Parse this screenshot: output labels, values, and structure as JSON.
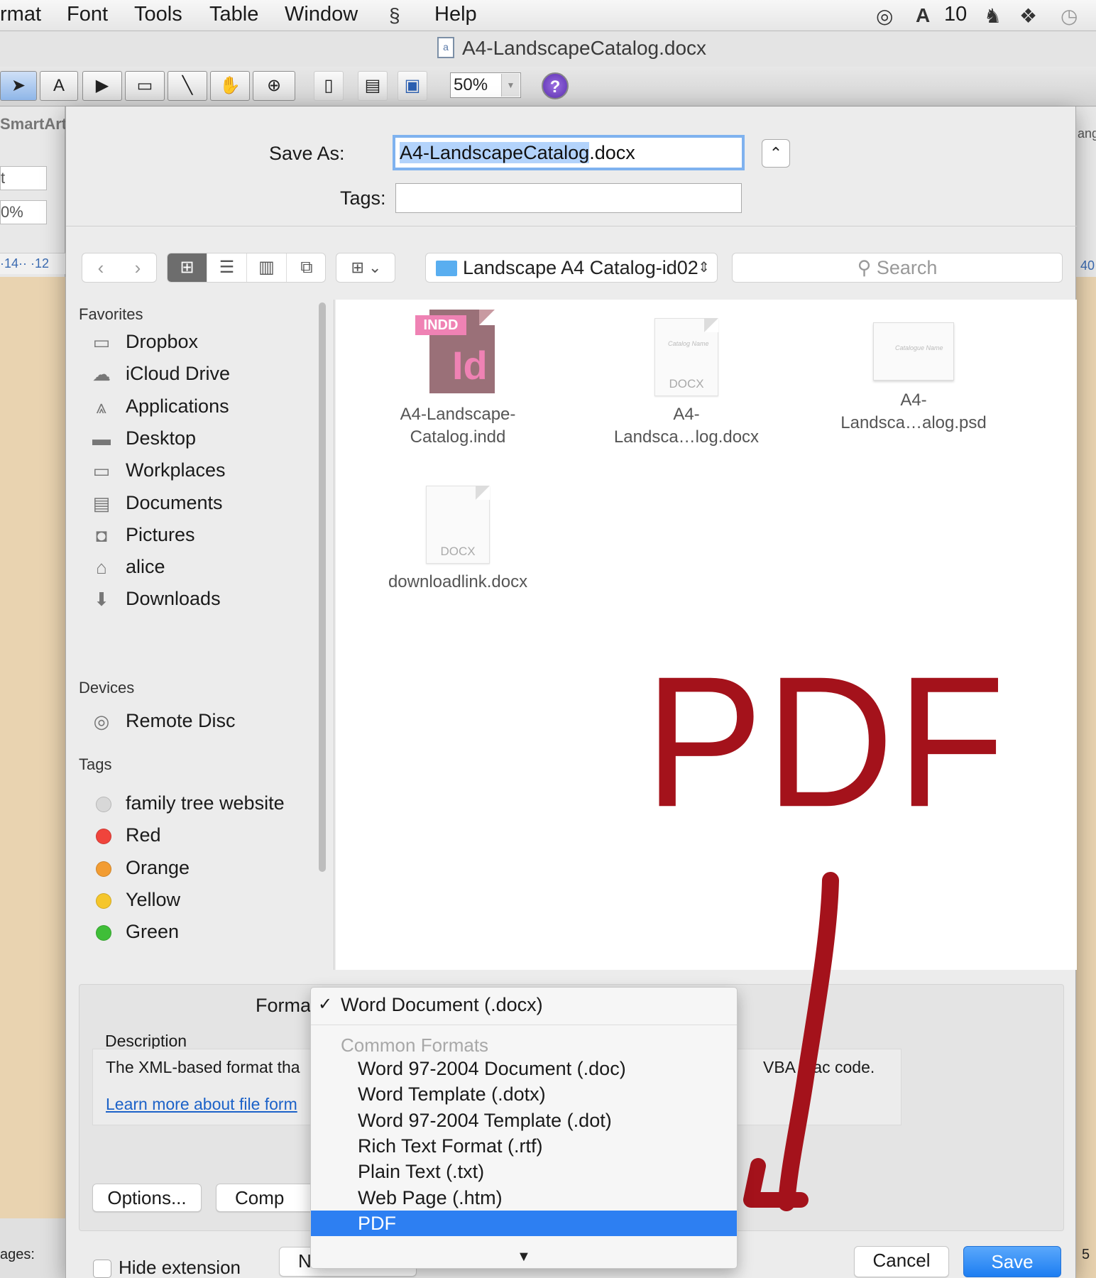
{
  "menubar": {
    "items": [
      "rmat",
      "Font",
      "Tools",
      "Table",
      "Window",
      "Help"
    ],
    "status_count": "10"
  },
  "window": {
    "title": "A4-LandscapeCatalog.docx"
  },
  "toolbar": {
    "zoom": "50%",
    "help": "?"
  },
  "left_panel": {
    "smartart": "SmartArt",
    "stepper1": "t",
    "stepper2": "0%",
    "ruler": "·14·· ·12"
  },
  "right_panel": {
    "label": "ang",
    "ruler": "40"
  },
  "status": {
    "left": "ages:",
    "right": "5"
  },
  "dialog": {
    "save_as_label": "Save As:",
    "filename_selected": "A4-LandscapeCatalog",
    "filename_ext": ".docx",
    "tags_label": "Tags:",
    "location": "Landscape A4 Catalog-id02",
    "search_placeholder": "Search"
  },
  "sidebar": {
    "favorites_heading": "Favorites",
    "favorites": [
      {
        "label": "Dropbox",
        "icon": "folder-icon"
      },
      {
        "label": "iCloud Drive",
        "icon": "cloud-icon"
      },
      {
        "label": "Applications",
        "icon": "applications-icon"
      },
      {
        "label": "Desktop",
        "icon": "desktop-icon"
      },
      {
        "label": "Workplaces",
        "icon": "folder-icon"
      },
      {
        "label": "Documents",
        "icon": "documents-icon"
      },
      {
        "label": "Pictures",
        "icon": "camera-icon"
      },
      {
        "label": "alice",
        "icon": "home-icon"
      },
      {
        "label": "Downloads",
        "icon": "download-icon"
      }
    ],
    "devices_heading": "Devices",
    "devices": [
      {
        "label": "Remote Disc",
        "icon": "disc-icon"
      }
    ],
    "tags_heading": "Tags",
    "tags": [
      {
        "label": "family tree website",
        "color": "#d8d8d8"
      },
      {
        "label": "Red",
        "color": "#f0443c"
      },
      {
        "label": "Orange",
        "color": "#f29c32"
      },
      {
        "label": "Yellow",
        "color": "#f5c62b"
      },
      {
        "label": "Green",
        "color": "#3fbe38"
      }
    ]
  },
  "files": [
    {
      "name_line1": "A4-Landscape-",
      "name_line2": "Catalog.indd",
      "type": "INDD",
      "letters": "Id"
    },
    {
      "name_line1": "A4-",
      "name_line2": "Landsca…log.docx",
      "type": "DOCX"
    },
    {
      "name_line1": "A4-",
      "name_line2": "Landsca…alog.psd",
      "type": "PSD"
    },
    {
      "name_line1": "downloadlink.docx",
      "name_line2": "",
      "type": "DOCX"
    }
  ],
  "overlay": {
    "text": "PDF",
    "color": "#a4121b"
  },
  "accessory": {
    "format_label": "Forma",
    "description_heading": "Description",
    "description_text": "The XML-based format tha",
    "description_tail": "VBA mac  code.",
    "learn_more": "Learn more about file form",
    "options_button": "Options...",
    "compat_button": "Comp"
  },
  "dropdown": {
    "selected": "Word Document (.docx)",
    "group_heading": "Common Formats",
    "items": [
      "Word 97-2004 Document (.doc)",
      "Word Template (.dotx)",
      "Word 97-2004 Template (.dot)",
      "Rich Text Format (.rtf)",
      "Plain Text (.txt)",
      "Web Page (.htm)",
      "PDF"
    ],
    "highlighted": "PDF"
  },
  "footer": {
    "hide_extension": "Hide extension",
    "new_folder": "N",
    "cancel": "Cancel",
    "save": "Save"
  }
}
